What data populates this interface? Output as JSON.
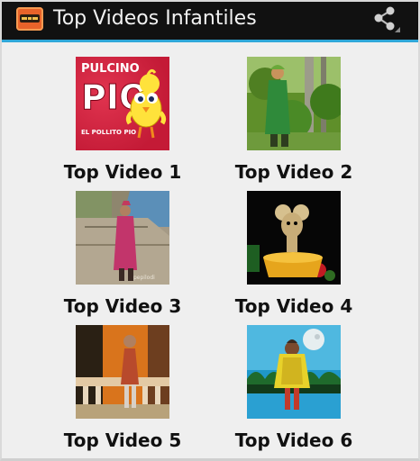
{
  "app": {
    "title": "Top Videos Infantiles",
    "icon": "app-logo-icon",
    "share_icon": "share-icon"
  },
  "thumb1": {
    "brand": "PULCINO",
    "name": "PIO",
    "caption": "EL POLLITO PIO"
  },
  "videos": [
    {
      "label": "Top Video 1",
      "thumb": "pulcino-pio-thumbnail"
    },
    {
      "label": "Top Video 2",
      "thumb": "green-forest-thumbnail"
    },
    {
      "label": "Top Video 3",
      "thumb": "coastal-fort-thumbnail"
    },
    {
      "label": "Top Video 4",
      "thumb": "mouse-puppet-thumbnail"
    },
    {
      "label": "Top Video 5",
      "thumb": "orange-wall-thumbnail"
    },
    {
      "label": "Top Video 6",
      "thumb": "night-moon-thumbnail"
    }
  ],
  "colors": {
    "actionbar": "#111111",
    "actionbar_accent": "#2fa7d8",
    "background": "#efefef",
    "label": "#111111"
  }
}
